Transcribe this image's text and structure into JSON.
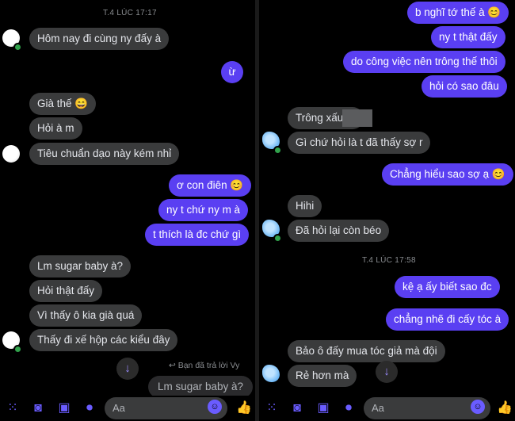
{
  "left": {
    "timestamp": "T.4 LÚC 17:17",
    "messages": [
      {
        "text": "Hôm nay đi cùng ny đấy à"
      },
      {
        "text": "ừ"
      },
      {
        "text": "Già thế 😄"
      },
      {
        "text": "Hỏi à m"
      },
      {
        "text": "Tiêu chuẩn dạo này kém nhỉ"
      },
      {
        "text": "ơ con điên 😊"
      },
      {
        "text": "ny t chứ ny m à"
      },
      {
        "text": "t thích là đc chứ gì"
      },
      {
        "text": "Lm sugar baby à?"
      },
      {
        "text": "Hỏi thật đấy"
      },
      {
        "text": "Vì thấy ô kia già quá"
      },
      {
        "text": "Thấy đi xế hộp các kiểu đây"
      }
    ],
    "reply_hint": "↩ Bạn đã trả lời Vy",
    "quoted": "Lm sugar baby à?",
    "composer": {
      "placeholder": "Aa"
    }
  },
  "right": {
    "messages_top": [
      {
        "text": "b nghĩ tớ thế à 😊"
      },
      {
        "text": "ny t thật đấy"
      },
      {
        "text": "do công việc nên trông thế thôi"
      },
      {
        "text": "hỏi có sao đâu"
      },
      {
        "text": "Trông xấu ra"
      },
      {
        "text": "Gì chứ hỏi là t đã thấy sợ r"
      },
      {
        "text": "Chẳng hiểu sao sợ ạ 😊"
      },
      {
        "text": "Hihi"
      },
      {
        "text": "Đã hỏi lại còn béo"
      }
    ],
    "timestamp": "T.4 LÚC 17:58",
    "messages_bottom": [
      {
        "text": "kệ ạ ấy biết sao đc"
      },
      {
        "text": "chẳng nhẽ đi cấy tóc à"
      },
      {
        "text": "Bảo ô đấy mua tóc giả mà đội"
      },
      {
        "text": "Rẻ hơn mà"
      }
    ],
    "composer": {
      "placeholder": "Aa"
    }
  },
  "icons": {
    "menu": "grid-dots-icon",
    "camera": "camera-icon",
    "image": "image-icon",
    "mic": "microphone-icon",
    "emoji": "emoji-icon",
    "like": "thumbs-up-icon",
    "scroll": "arrow-down-icon"
  },
  "colors": {
    "outgoing": "#5a3ff2",
    "incoming": "#3a3b3c",
    "accent": "#6a5cff",
    "background": "#000000"
  }
}
